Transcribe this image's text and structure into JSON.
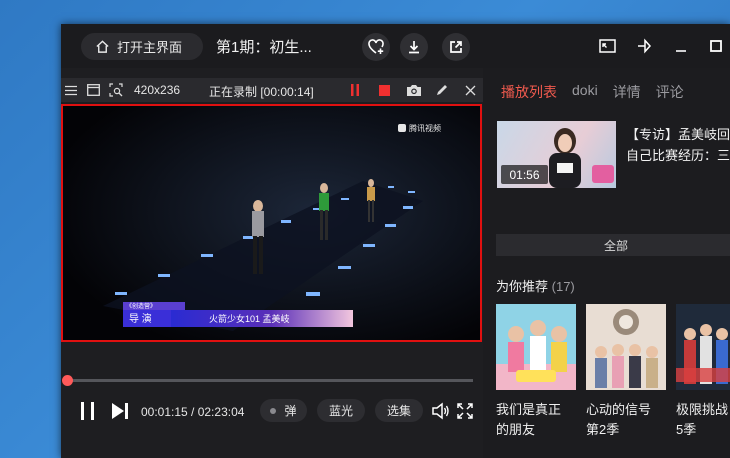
{
  "titlebar": {
    "home_label": "打开主界面",
    "episode_title": "第1期：初生..."
  },
  "recorder": {
    "size": "420x236",
    "status": "正在录制 [00:00:14]"
  },
  "video": {
    "watermark": "腾讯视频",
    "caption_show": "《创造营》",
    "caption_role": "导  演",
    "caption_name": "火箭少女101 孟美岐",
    "progress": 0.009
  },
  "controls": {
    "time": "00:01:15 / 02:23:04",
    "danmu_label": "弹",
    "quality_label": "蓝光",
    "episodes_label": "选集"
  },
  "sidebar": {
    "tabs": [
      {
        "label": "播放列表",
        "active": true
      },
      {
        "label": "doki",
        "active": false
      },
      {
        "label": "详情",
        "active": false
      },
      {
        "label": "评论",
        "active": false
      }
    ],
    "featured": {
      "title_line1": "【专访】孟美岐回",
      "title_line2": "自己比赛经历：三",
      "duration": "01:56"
    },
    "all_label": "全部",
    "recommend": {
      "heading": "为你推荐",
      "count": "(17)",
      "items": [
        {
          "title": "我们是真正\n的朋友"
        },
        {
          "title": "心动的信号\n第2季"
        },
        {
          "title": "极限挑战\n5季"
        }
      ]
    }
  },
  "colors": {
    "accent": "#f05a4e",
    "record_red": "#e01010"
  }
}
